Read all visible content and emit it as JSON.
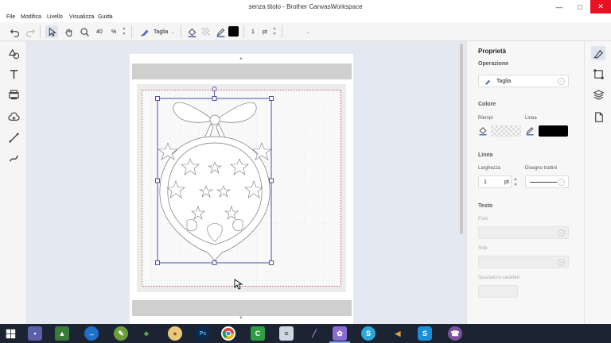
{
  "app": {
    "title": "senza titolo - Brother CanvasWorkspace",
    "window_controls": {
      "minimize": "—",
      "maximize": "□",
      "close": "✕"
    }
  },
  "menu": {
    "items": [
      "File",
      "Modifica",
      "Livello",
      "Visualizza",
      "Guida"
    ]
  },
  "toolbar": {
    "zoom_value": "40",
    "zoom_unit": "%",
    "operation_label": "Taglia",
    "line_width_value": "1",
    "line_width_unit": "pt"
  },
  "properties": {
    "panel_title": "Proprietà",
    "operation_section": "Operazione",
    "operation_value": "Taglia",
    "color_section": "Colore",
    "fill_label": "Riempi",
    "line_label": "Linea",
    "line_color": "#000000",
    "line_section": "Linea",
    "width_label": "Larghezza",
    "width_value": "1",
    "width_unit": "pt",
    "dash_label": "Disegno trattini",
    "text_section": "Testo",
    "font_label": "Font",
    "style_label": "Stile",
    "spacing_label": "Spaziatura caratteri"
  },
  "colors": {
    "accent": "#5b6bc9",
    "selection": "#3a3fa0",
    "canvas_bg": "#e4e8f0",
    "close_red": "#e81123",
    "taskbar": "#1c2333"
  },
  "icons": {
    "left_rail": [
      "shapes-icon",
      "text-icon",
      "image-trace-icon",
      "cloud-icon",
      "line-icon",
      "freehand-icon"
    ],
    "right_rail": [
      "properties-icon",
      "transform-icon",
      "layers-icon",
      "page-icon"
    ],
    "taskbar": [
      "start-icon",
      "save-app-icon",
      "photos-icon",
      "teamviewer-icon",
      "app-leaf-icon",
      "clover-icon",
      "paint-icon",
      "photoshop-icon",
      "chrome-icon",
      "camtasia-icon",
      "notes-icon",
      "pen-icon",
      "canvasworkspace-icon",
      "skype-icon",
      "volume-icon",
      "skype-icon-2",
      "viber-icon"
    ]
  }
}
